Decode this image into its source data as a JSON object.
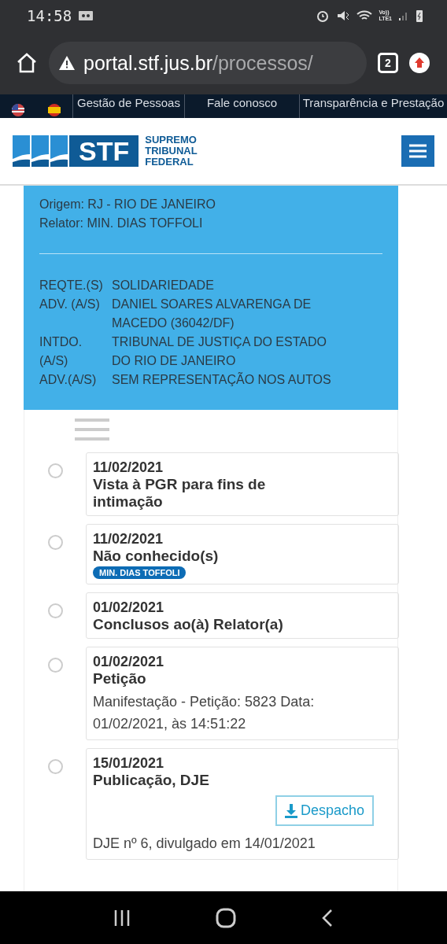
{
  "status_bar": {
    "time": "14:58",
    "network_label": [
      "Vo))",
      "LTE1"
    ]
  },
  "browser": {
    "url_host": "portal.stf.jus.br",
    "url_path": "/processos/",
    "tab_count": "2"
  },
  "top_nav": {
    "links": [
      "Gestão de Pessoas",
      "Fale conosco",
      "Transparência e Prestação"
    ]
  },
  "header": {
    "logo_mark": "STF",
    "logo_name": [
      "SUPREMO",
      "TRIBUNAL",
      "FEDERAL"
    ]
  },
  "case_panel": {
    "details": [
      "Origem: RJ - RIO DE JANEIRO",
      "Relator: MIN. DIAS TOFFOLI"
    ],
    "parties": [
      {
        "role": "REQTE.(S)",
        "name": "SOLIDARIEDADE"
      },
      {
        "role": "ADV. (A/S)",
        "name": "DANIEL SOARES ALVARENGA DE MACEDO (36042/DF)"
      },
      {
        "role": "INTDO. (A/S)",
        "name": "TRIBUNAL DE JUSTIÇA DO ESTADO DO RIO DE JANEIRO"
      },
      {
        "role": "ADV.(A/S)",
        "name": "SEM REPRESENTAÇÃO NOS AUTOS"
      }
    ]
  },
  "timeline": [
    {
      "date": "11/02/2021",
      "title": "Vista à PGR para fins de intimação"
    },
    {
      "date": "11/02/2021",
      "title": "Não conhecido(s)",
      "badge": "MIN. DIAS TOFFOLI"
    },
    {
      "date": "01/02/2021",
      "title": "Conclusos ao(à) Relator(a)"
    },
    {
      "date": "01/02/2021",
      "title": "Petição",
      "description": "Manifestação - Petição: 5823 Data: 01/02/2021, às 14:51:22"
    },
    {
      "date": "15/01/2021",
      "title": "Publicação, DJE",
      "button": "Despacho",
      "description": "DJE nº 6, divulgado em 14/01/2021"
    }
  ]
}
